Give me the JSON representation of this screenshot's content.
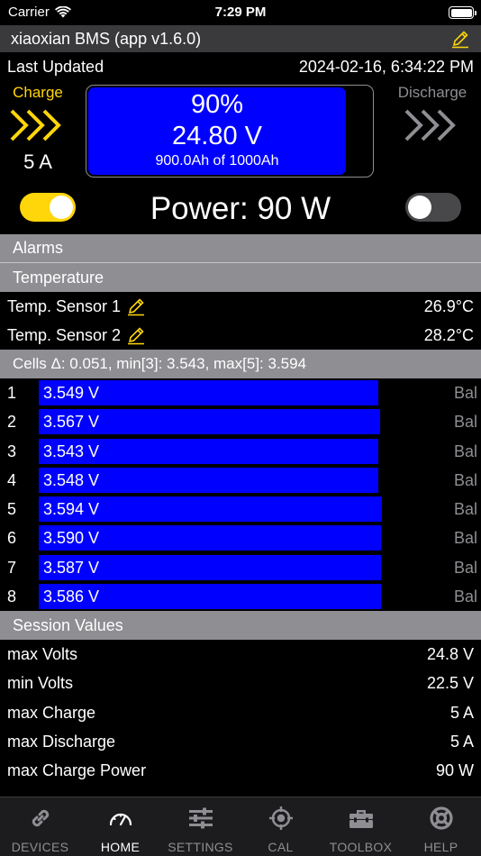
{
  "status_bar": {
    "carrier": "Carrier",
    "time": "7:29 PM"
  },
  "title": "xiaoxian BMS (app v1.6.0)",
  "last_updated": {
    "label": "Last Updated",
    "value": "2024-02-16, 6:34:22 PM"
  },
  "battery": {
    "percent": "90%",
    "percent_value": 0.9,
    "voltage": "24.80 V",
    "capacity": "900.0Ah of 1000Ah"
  },
  "charge": {
    "label": "Charge",
    "current": "5 A",
    "color": "#ffd60a",
    "enabled": true
  },
  "discharge": {
    "label": "Discharge",
    "color": "#8e8e93",
    "enabled": false
  },
  "power": "Power: 90 W",
  "sections": {
    "alarms": "Alarms",
    "temperature": "Temperature",
    "cells": "Cells Δ: 0.051, min[3]: 3.543, max[5]: 3.594",
    "session": "Session Values"
  },
  "temperatures": [
    {
      "name": "Temp. Sensor 1",
      "value": "26.9°C"
    },
    {
      "name": "Temp. Sensor 2",
      "value": "28.2°C"
    }
  ],
  "cells": [
    {
      "index": "1",
      "voltage": "3.549 V",
      "v": 3.549,
      "bal": "Bal"
    },
    {
      "index": "2",
      "voltage": "3.567 V",
      "v": 3.567,
      "bal": "Bal"
    },
    {
      "index": "3",
      "voltage": "3.543 V",
      "v": 3.543,
      "bal": "Bal"
    },
    {
      "index": "4",
      "voltage": "3.548 V",
      "v": 3.548,
      "bal": "Bal"
    },
    {
      "index": "5",
      "voltage": "3.594 V",
      "v": 3.594,
      "bal": "Bal"
    },
    {
      "index": "6",
      "voltage": "3.590 V",
      "v": 3.59,
      "bal": "Bal"
    },
    {
      "index": "7",
      "voltage": "3.587 V",
      "v": 3.587,
      "bal": "Bal"
    },
    {
      "index": "8",
      "voltage": "3.586 V",
      "v": 3.586,
      "bal": "Bal"
    }
  ],
  "session_values": [
    {
      "label": "max Volts",
      "value": "24.8 V"
    },
    {
      "label": "min Volts",
      "value": "22.5 V"
    },
    {
      "label": "max Charge",
      "value": "5 A"
    },
    {
      "label": "max Discharge",
      "value": "5 A"
    },
    {
      "label": "max Charge Power",
      "value": "90 W"
    }
  ],
  "tabs": [
    {
      "label": "DEVICES",
      "icon": "link-icon"
    },
    {
      "label": "HOME",
      "icon": "gauge-icon",
      "active": true
    },
    {
      "label": "SETTINGS",
      "icon": "sliders-icon"
    },
    {
      "label": "CAL",
      "icon": "crosshair-icon"
    },
    {
      "label": "TOOLBOX",
      "icon": "toolbox-icon"
    },
    {
      "label": "HELP",
      "icon": "lifebuoy-icon"
    }
  ],
  "colors": {
    "accent": "#ffd60a",
    "bar": "#0000ff",
    "section": "#8e8e93"
  }
}
